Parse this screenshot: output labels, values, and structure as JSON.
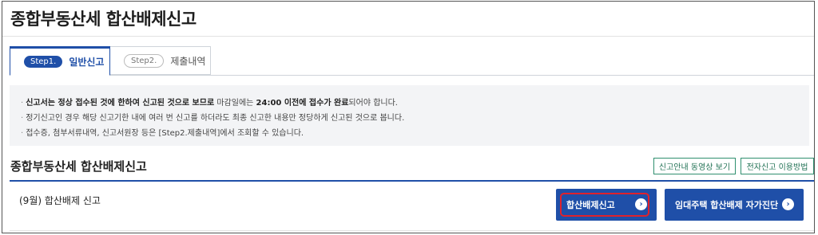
{
  "page": {
    "title": "종합부동산세 합산배제신고"
  },
  "tabs": [
    {
      "step": "Step1.",
      "label": "일반신고",
      "active": true
    },
    {
      "step": "Step2.",
      "label": "제출내역",
      "active": false
    }
  ],
  "notice": {
    "line1": {
      "bold1": "신고서는 정상 접수된 것에 한하여 신고된 것으로 보므로",
      "text1": " 마감일에는 ",
      "bold2": "24:00 이전에 접수가 완료",
      "text2": "되어야 합니다."
    },
    "line2": "정기신고인 경우 해당 신고기한 내에 여러 번 신고를 하더라도 최종 신고한 내용만 정당하게 신고된 것으로 봅니다.",
    "line3": "접수증, 첨부서류내역, 신고서원장 등은 [Step2.제출내역]에서 조회할 수 있습니다."
  },
  "section": {
    "title": "종합부동산세 합산배제신고",
    "video_button": "신고안내 동영상 보기",
    "guide_button": "전자신고 이용방법"
  },
  "row": {
    "label": "(9월) 합산배제 신고",
    "report_button": "합산배제신고",
    "check_button": "임대주택 합산배제 자가진단"
  },
  "colors": {
    "primary": "#1f4fa8",
    "highlight": "#e0212b",
    "outline_green": "#2f8f6f",
    "notice_bg": "#f3f4f6"
  },
  "icons": {
    "arrow": "›",
    "bullet": "·"
  }
}
